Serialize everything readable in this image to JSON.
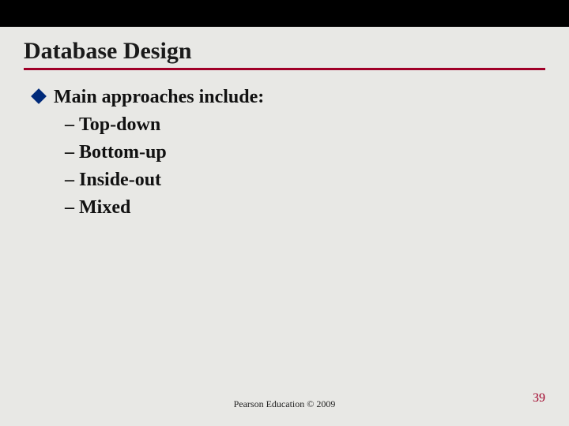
{
  "slide": {
    "title": "Database Design",
    "lead": "Main approaches include:",
    "items": [
      {
        "label": "Top-down"
      },
      {
        "label": "Bottom-up"
      },
      {
        "label": "Inside-out"
      },
      {
        "label": "Mixed"
      }
    ],
    "dash": "–",
    "footer": "Pearson Education © 2009",
    "page_number": "39"
  }
}
